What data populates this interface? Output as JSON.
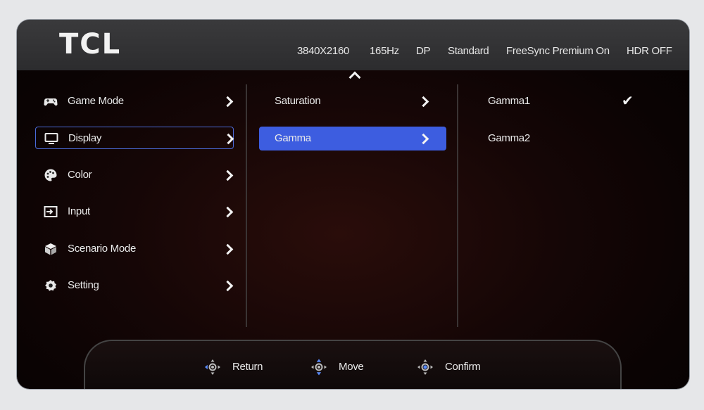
{
  "header": {
    "logo": "TCL",
    "resolution": "3840X2160",
    "refresh_rate": "165Hz",
    "input": "DP",
    "picture_mode": "Standard",
    "freesync": "FreeSync Premium On",
    "hdr": "HDR OFF"
  },
  "main_menu": {
    "items": [
      {
        "label": "Game Mode",
        "icon": "gamepad-icon"
      },
      {
        "label": "Display",
        "icon": "monitor-icon",
        "selected": true
      },
      {
        "label": "Color",
        "icon": "palette-icon"
      },
      {
        "label": "Input",
        "icon": "input-icon"
      },
      {
        "label": "Scenario Mode",
        "icon": "cube-icon"
      },
      {
        "label": "Setting",
        "icon": "gear-icon"
      }
    ]
  },
  "sub_menu": {
    "items": [
      {
        "label": "Saturation"
      },
      {
        "label": "Gamma",
        "highlighted": true
      }
    ]
  },
  "options": {
    "items": [
      {
        "label": "Gamma1",
        "checked": true
      },
      {
        "label": "Gamma2",
        "checked": false
      }
    ]
  },
  "footer": {
    "return_label": "Return",
    "move_label": "Move",
    "confirm_label": "Confirm"
  },
  "colors": {
    "accent": "#3d5de0",
    "header_bg": "#333335",
    "panel_bg": "#120606"
  }
}
